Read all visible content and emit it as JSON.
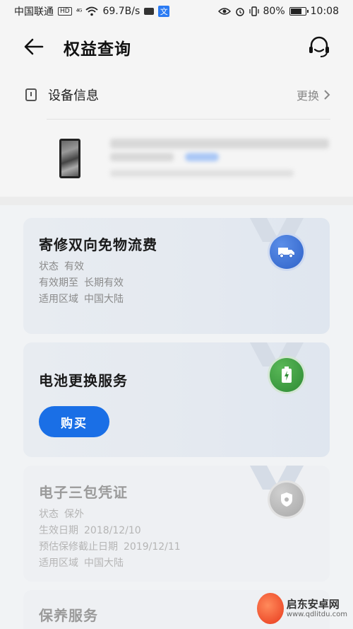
{
  "status_bar": {
    "carrier": "中国联通",
    "hd_badge": "HD",
    "signal": "⁴ᴳ",
    "speed": "69.7B/s",
    "input_method": "文",
    "battery": "80%",
    "time": "10:08"
  },
  "header": {
    "title": "权益查询"
  },
  "device_section": {
    "label": "设备信息",
    "change_label": "更换"
  },
  "cards": [
    {
      "title": "寄修双向免物流费",
      "icon": "truck-icon",
      "fields": [
        {
          "key": "状态",
          "value": "有效"
        },
        {
          "key": "有效期至",
          "value": "长期有效"
        },
        {
          "key": "适用区域",
          "value": "中国大陆"
        }
      ]
    },
    {
      "title": "电池更换服务",
      "icon": "battery-icon",
      "button_label": "购买"
    },
    {
      "title": "电子三包凭证",
      "icon": "shield-icon",
      "fields": [
        {
          "key": "状态",
          "value": "保外"
        },
        {
          "key": "生效日期",
          "value": "2018/12/10"
        },
        {
          "key": "预估保修截止日期",
          "value": "2019/12/11"
        },
        {
          "key": "适用区域",
          "value": "中国大陆"
        }
      ]
    },
    {
      "title": "保养服务"
    }
  ],
  "watermark": {
    "name": "启东安卓网",
    "url": "www.qdlitdu.com"
  },
  "colors": {
    "primary_button": "#1a6fe6",
    "medal_blue": "#2f62c8",
    "medal_green": "#2e8a34"
  }
}
